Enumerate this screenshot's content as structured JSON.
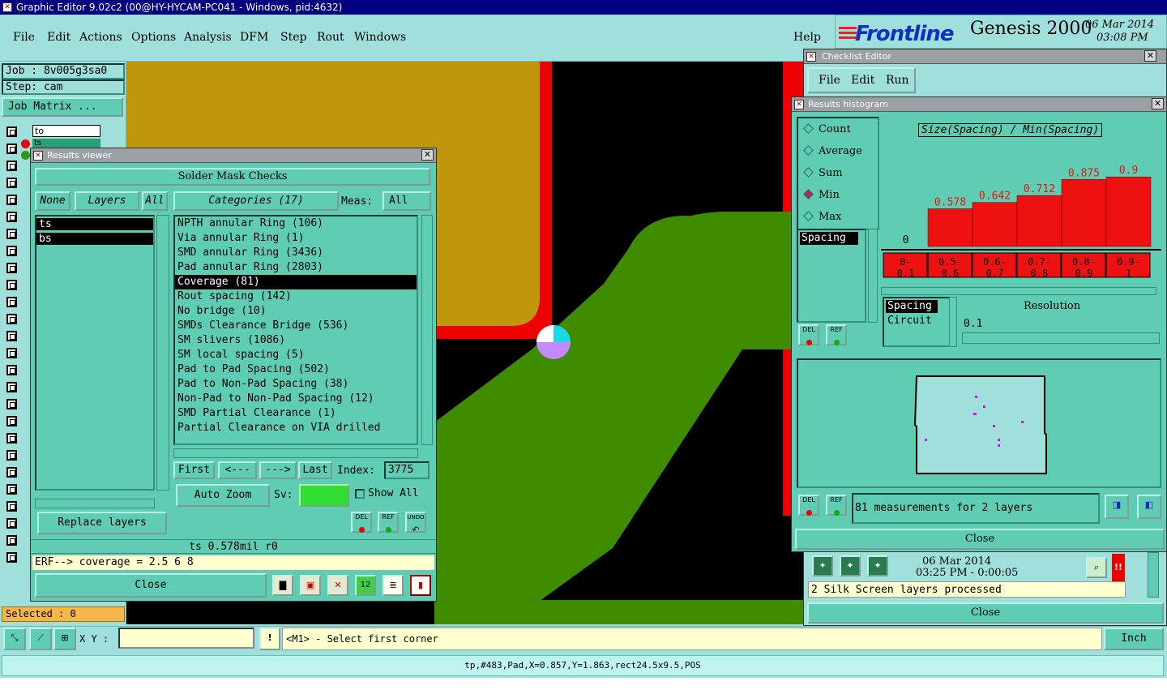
{
  "window": {
    "title": "Graphic Editor 9.02c2 (00@HY-HYCAM-PC041 - Windows, pid:4632)"
  },
  "menu": [
    "File",
    "Edit",
    "Actions",
    "Options",
    "Analysis",
    "DFM",
    "Step",
    "Rout",
    "Windows"
  ],
  "help": "Help",
  "brand": {
    "logo": "Frontline",
    "product": "Genesis 2000",
    "date": "06 Mar 2014",
    "time": "03:08 PM"
  },
  "job": {
    "job": "Job : 8v005g3sa0",
    "step": "Step: cam",
    "matrix_btn": "Job Matrix ..."
  },
  "layers_mini": {
    "row1": "to",
    "row2": "ts"
  },
  "selected": "Selected : 0",
  "results_viewer": {
    "title": "Results viewer",
    "header": "Solder Mask Checks",
    "none_btn": "None",
    "layers_btn": "Layers",
    "all_btn": "All",
    "layers": [
      "ts",
      "bs"
    ],
    "categories_btn": "Categories (17)",
    "meas_label": "Meas:",
    "meas_value": "All",
    "categories": [
      "NPTH annular Ring (106)",
      "Via annular Ring (1)",
      "SMD annular Ring (3436)",
      "Pad annular Ring (2803)",
      "Coverage (81)",
      "Rout spacing (142)",
      "No bridge (10)",
      "SMDs Clearance Bridge (536)",
      "SM slivers (1086)",
      "SM local spacing (5)",
      "Pad to Pad Spacing (502)",
      "Pad to Non-Pad Spacing (38)",
      "Non-Pad to Non-Pad Spacing (12)",
      "SMD Partial Clearance (1)",
      "Partial Clearance on VIA drilled"
    ],
    "first": "First",
    "prev": "<---",
    "next": "--->",
    "last": "Last",
    "index_label": "Index:",
    "index_value": "3775",
    "auto_zoom": "Auto Zoom",
    "sv_label": "Sv:",
    "show_all": "Show All",
    "replace_layers": "Replace layers",
    "del": "DEL",
    "ref": "REF",
    "undo": "UNDO",
    "status": "ts 0.578mil  r0",
    "erf": "ERF--> coverage = 2.5 6 8",
    "close": "Close"
  },
  "checklist": {
    "title": "Checklist Editor",
    "menu": [
      "File",
      "Edit",
      "Run"
    ]
  },
  "histogram": {
    "title": "Results histogram",
    "options": [
      "Count",
      "Average",
      "Sum",
      "Min",
      "Max"
    ],
    "selected_option": "Min",
    "chart_title": "Size(Spacing) / Min(Spacing)",
    "measure_list": [
      "Spacing"
    ],
    "type_list": [
      "Spacing",
      "Circuit"
    ],
    "resolution_label": "Resolution",
    "resolution_value": "0.1",
    "measurements": "81 measurements for 2 layers",
    "del": "DEL",
    "ref": "REF",
    "close": "Close",
    "bar_color": "#ee1111"
  },
  "chart_data": {
    "type": "bar",
    "title": "Size(Spacing) / Min(Spacing)",
    "categories": [
      "0-\n0.1",
      "0.5-\n0.6",
      "0.6-\n0.7",
      "0.7-\n0.8",
      "0.8-\n0.9",
      "0.9-\n1"
    ],
    "values": [
      0,
      0.578,
      0.642,
      0.712,
      0.875,
      0.9
    ],
    "value_labels": [
      "0",
      "0.578",
      "0.642",
      "0.712",
      "0.875",
      "0.9"
    ]
  },
  "monitor": {
    "date": "06 Mar 2014",
    "time": "03:25 PM - 0:00:05",
    "message": "2 Silk Screen layers processed",
    "close": "Close",
    "alert": "!!"
  },
  "bottom": {
    "xy_label": "X Y :",
    "xy_value": "",
    "prompt": "<M1> - Select first corner",
    "units": "Inch",
    "status": "tp,#483,Pad,X=0.857,Y=1.863,rect24.5x9.5,POS"
  }
}
